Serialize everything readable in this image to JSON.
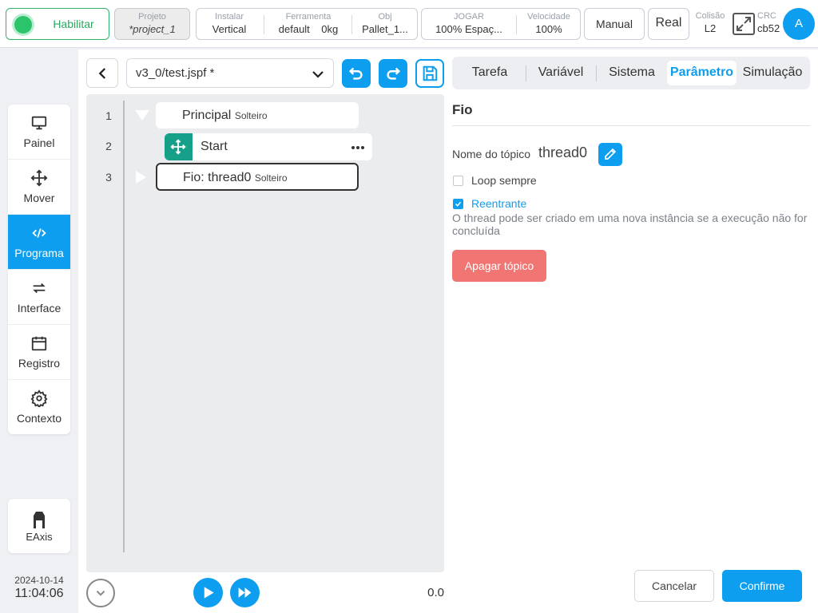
{
  "topbar": {
    "enable_label": "Habilitar",
    "project": {
      "key": "Projeto",
      "value": "*project_1"
    },
    "install": {
      "key": "Instalar",
      "value": "Vertical"
    },
    "tool": {
      "key": "Ferramenta",
      "value1": "default",
      "value2": "0kg"
    },
    "obj": {
      "key": "Obj",
      "value": "Pallet_1..."
    },
    "jog": {
      "key": "JOGAR",
      "value": "100%  Espaç..."
    },
    "speed": {
      "key": "Velocidade",
      "value": "100%"
    },
    "manual_label": "Manual",
    "real_label": "Real",
    "collision": {
      "key": "Colisão",
      "value": "L2"
    },
    "crc": {
      "key": "CRC",
      "value": "cb52"
    },
    "avatar_letter": "A"
  },
  "sidebar": {
    "items": [
      {
        "label": "Painel",
        "icon": "monitor-icon"
      },
      {
        "label": "Mover",
        "icon": "move-icon"
      },
      {
        "label": "Programa",
        "icon": "code-icon",
        "active": true
      },
      {
        "label": "Interface",
        "icon": "swap-icon"
      },
      {
        "label": "Registro",
        "icon": "calendar-icon"
      },
      {
        "label": "Contexto",
        "icon": "gear-icon"
      }
    ],
    "eaxis_label": "EAxis"
  },
  "clock": {
    "date": "2024-10-14",
    "time": "11:04:06"
  },
  "editor": {
    "file": "v3_0/test.jspf *",
    "lines": [
      {
        "n": "1",
        "label": "Principal",
        "sub": "Solteiro"
      },
      {
        "n": "2",
        "label": "Start"
      },
      {
        "n": "3",
        "label": "Fio: thread0",
        "sub": "Solteiro"
      }
    ],
    "speed_value": "0.0"
  },
  "tabs": [
    "Tarefa",
    "Variável",
    "Sistema",
    "Parâmetro",
    "Simulação"
  ],
  "panel": {
    "title": "Fio",
    "topic_label": "Nome do tópico",
    "topic_value": "thread0",
    "loop_label": "Loop sempre",
    "reentrant_label": "Reentrante",
    "hint": "O thread pode ser criado em uma nova instância se a execução não for concluída",
    "delete_label": "Apagar tópico",
    "cancel_label": "Cancelar",
    "confirm_label": "Confirme"
  },
  "colors": {
    "accent": "#0d9ef0",
    "enable": "#2bc46a",
    "danger": "#f07573",
    "move_node": "#16a08a"
  }
}
